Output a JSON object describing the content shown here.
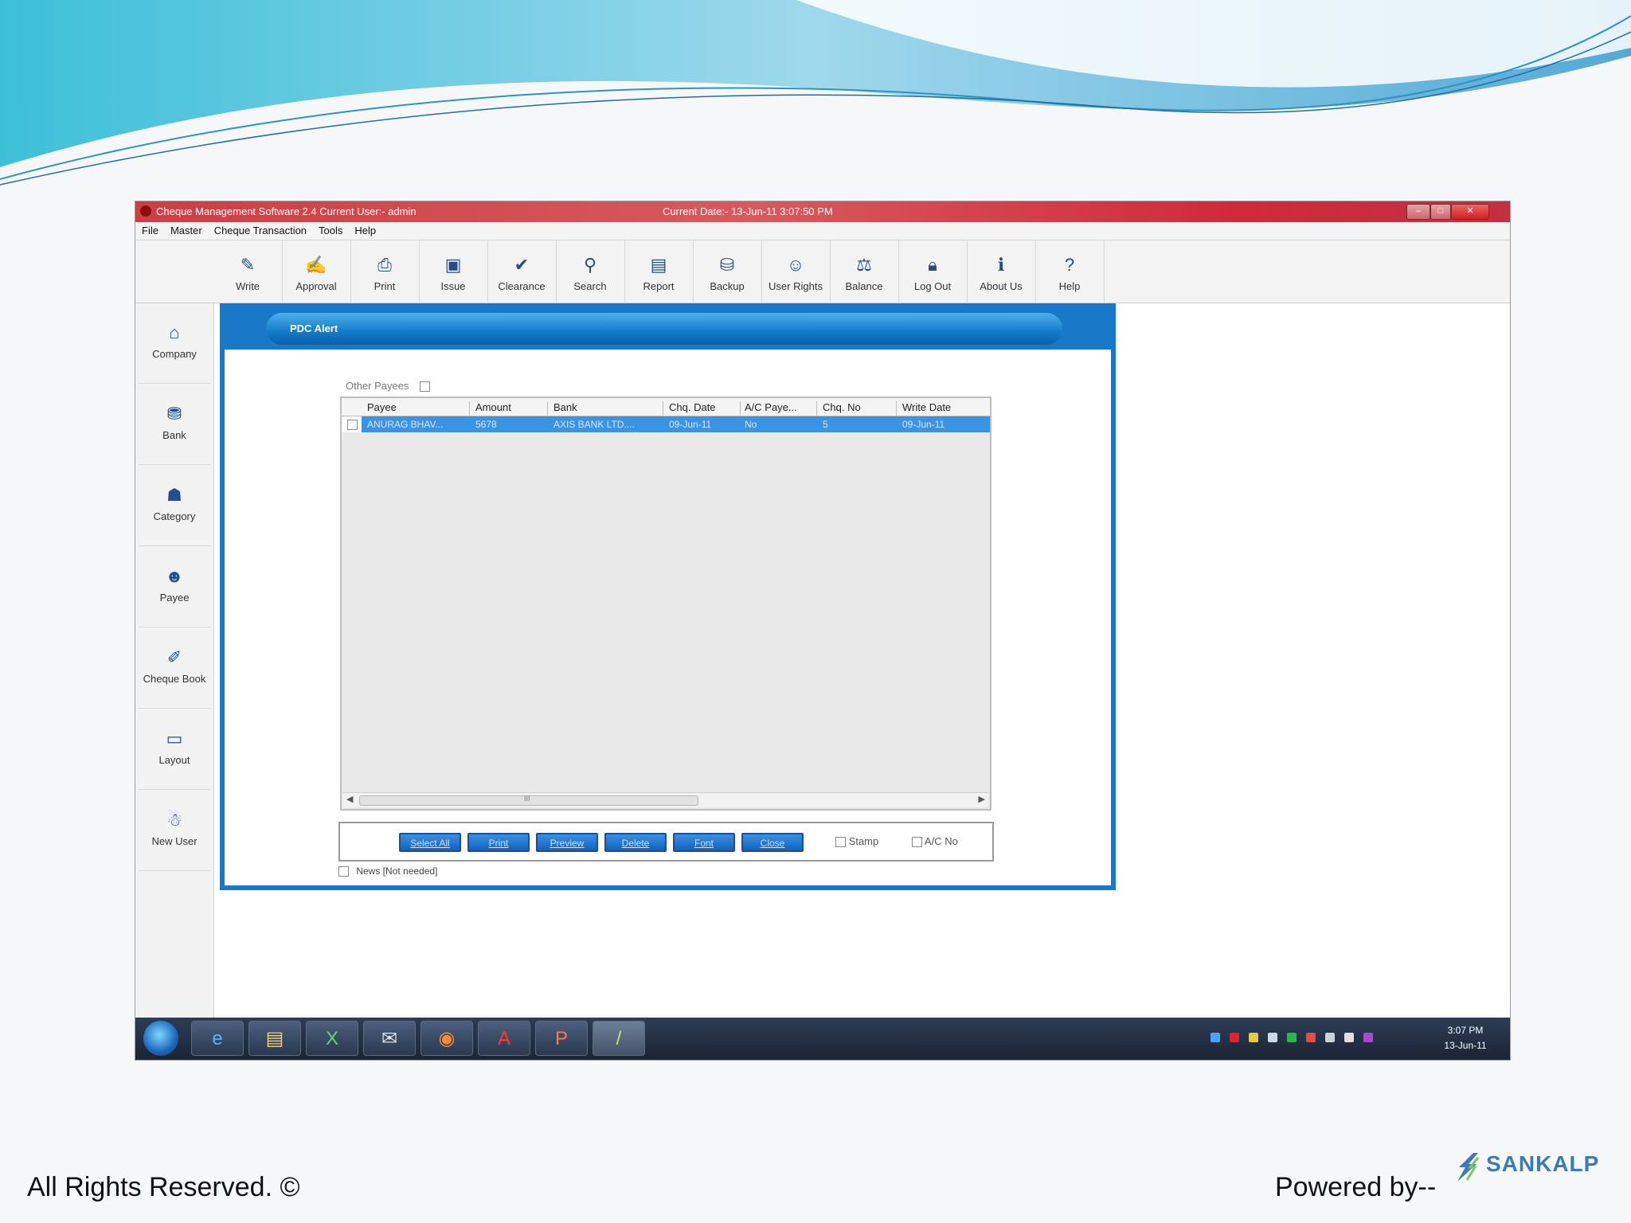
{
  "app": {
    "title": "Cheque Management Software 2.4   Current User:- admin",
    "current_date": "Current Date:- 13-Jun-11 3:07:50 PM",
    "window_controls": [
      "–",
      "□",
      "✕"
    ]
  },
  "menu": [
    "File",
    "Master",
    "Cheque Transaction",
    "Tools",
    "Help"
  ],
  "toolbar": [
    {
      "label": "Write",
      "icon": "write-icon"
    },
    {
      "label": "Approval",
      "icon": "approval-icon"
    },
    {
      "label": "Print",
      "icon": "print-icon"
    },
    {
      "label": "Issue",
      "icon": "issue-icon"
    },
    {
      "label": "Clearance",
      "icon": "clearance-icon"
    },
    {
      "label": "Search",
      "icon": "search-icon"
    },
    {
      "label": "Report",
      "icon": "report-icon"
    },
    {
      "label": "Backup",
      "icon": "backup-icon"
    },
    {
      "label": "User Rights",
      "icon": "user-rights-icon"
    },
    {
      "label": "Balance",
      "icon": "balance-icon"
    },
    {
      "label": "Log Out",
      "icon": "logout-icon"
    },
    {
      "label": "About Us",
      "icon": "about-icon"
    },
    {
      "label": "Help",
      "icon": "help-icon"
    }
  ],
  "sidebar": [
    {
      "label": "Company",
      "icon": "home-icon"
    },
    {
      "label": "Bank",
      "icon": "bank-icon"
    },
    {
      "label": "Category",
      "icon": "category-icon"
    },
    {
      "label": "Payee",
      "icon": "payee-icon"
    },
    {
      "label": "Cheque Book",
      "icon": "cheque-book-icon"
    },
    {
      "label": "Layout",
      "icon": "layout-icon"
    },
    {
      "label": "New User",
      "icon": "new-user-icon"
    }
  ],
  "pdc": {
    "title": "PDC Alert",
    "other_payees_label": "Other Payees",
    "columns": [
      "Payee",
      "Amount",
      "Bank",
      "Chq. Date",
      "A/C Paye...",
      "Chq. No",
      "Write Date"
    ],
    "rows": [
      [
        "ANURAG BHAV...",
        "5678",
        "AXIS BANK LTD....",
        "09-Jun-11",
        "No",
        "5",
        "09-Jun-11"
      ]
    ],
    "scroll_label": "III",
    "buttons": [
      "Select All",
      "Print",
      "Preview",
      "Delete",
      "Font",
      "Close"
    ],
    "options": [
      "Stamp",
      "A/C No"
    ],
    "news_label": "News [Not needed]"
  },
  "taskbar": {
    "apps": [
      "e",
      "▤",
      "X",
      "✉",
      "◉",
      "A",
      "P",
      "/"
    ],
    "clock_time": "3:07 PM",
    "clock_date": "13-Jun-11"
  },
  "footer": {
    "rights": "All Rights Reserved. ©",
    "powered": "Powered by--",
    "logo_text": "SANKALP"
  },
  "colors": {
    "accent": "#1a78c8",
    "selection": "#3b93e4",
    "titlebar": "#c94046",
    "slide_wave": "#5fc3e0"
  }
}
